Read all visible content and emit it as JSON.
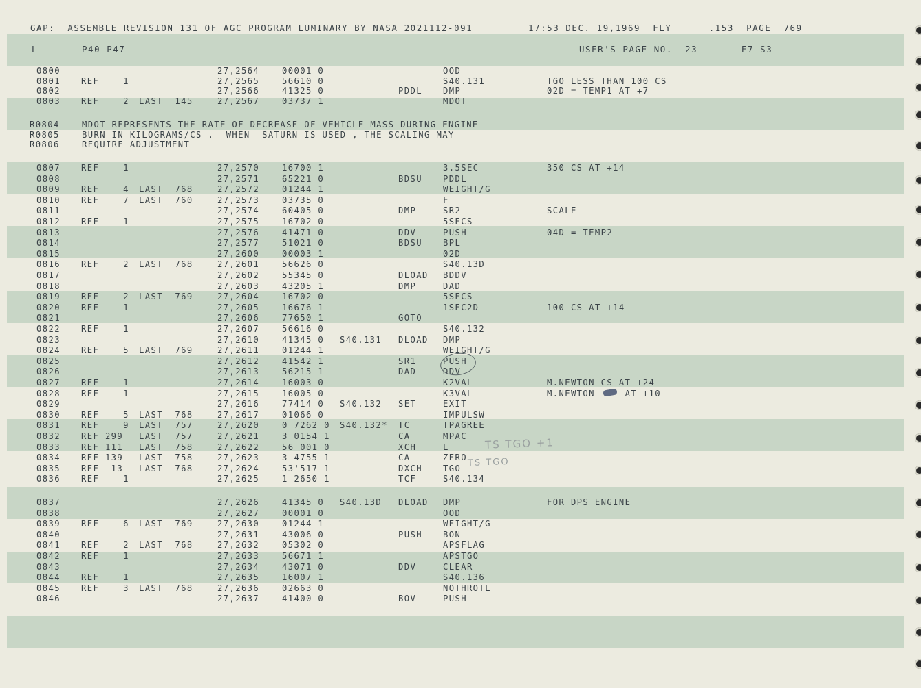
{
  "header": {
    "line1_left": "GAP:  ASSEMBLE REVISION 131 OF AGC PROGRAM LUMINARY BY NASA 2021112-091",
    "line1_right": "17:53 DEC. 19,1969  FLY      .153  PAGE  769",
    "band_l": "L",
    "band_section": "P40-P47",
    "band_users_page": "USER'S PAGE NO.  23",
    "band_code": "E7 S3"
  },
  "remarks": [
    {
      "line": "R0804",
      "text": "MDOT REPRESENTS THE RATE OF DECREASE OF VEHICLE MASS DURING ENGINE"
    },
    {
      "line": "R0805",
      "text": "BURN IN KILOGRAMS/CS .  WHEN  SATURN IS USED , THE SCALING MAY"
    },
    {
      "line": "R0806",
      "text": "REQUIRE ADJUSTMENT"
    }
  ],
  "rows_a": [
    {
      "line": "0800",
      "ref": "",
      "last": "",
      "addr": "27,2564",
      "word": "00001 0",
      "label": "",
      "op": "",
      "operand": "OOD",
      "comment": ""
    },
    {
      "line": "0801",
      "ref": "REF    1",
      "last": "",
      "addr": "27,2565",
      "word": "56610 0",
      "label": "",
      "op": "",
      "operand": "S40.131",
      "comment": "TGO LESS THAN 100 CS"
    },
    {
      "line": "0802",
      "ref": "",
      "last": "",
      "addr": "27,2566",
      "word": "41325 0",
      "label": "",
      "op": "PDDL",
      "operand": "DMP",
      "comment": "02D = TEMP1 AT +7"
    },
    {
      "line": "0803",
      "ref": "REF    2",
      "last": "LAST  145",
      "addr": "27,2567",
      "word": "03737 1",
      "label": "",
      "op": "",
      "operand": "MDOT",
      "comment": ""
    }
  ],
  "rows_b": [
    {
      "line": "0807",
      "ref": "REF    1",
      "last": "",
      "addr": "27,2570",
      "word": "16700 1",
      "label": "",
      "op": "",
      "operand": "3.5SEC",
      "comment": "350 CS AT +14"
    },
    {
      "line": "0808",
      "ref": "",
      "last": "",
      "addr": "27,2571",
      "word": "65221 0",
      "label": "",
      "op": "BDSU",
      "operand": "PDDL",
      "comment": ""
    },
    {
      "line": "0809",
      "ref": "REF    4",
      "last": "LAST  768",
      "addr": "27,2572",
      "word": "01244 1",
      "label": "",
      "op": "",
      "operand": "WEIGHT/G",
      "comment": ""
    },
    {
      "line": "0810",
      "ref": "REF    7",
      "last": "LAST  760",
      "addr": "27,2573",
      "word": "03735 0",
      "label": "",
      "op": "",
      "operand": "F",
      "comment": ""
    },
    {
      "line": "0811",
      "ref": "",
      "last": "",
      "addr": "27,2574",
      "word": "60405 0",
      "label": "",
      "op": "DMP",
      "operand": "SR2",
      "comment": "SCALE"
    },
    {
      "line": "0812",
      "ref": "REF    1",
      "last": "",
      "addr": "27,2575",
      "word": "16702 0",
      "label": "",
      "op": "",
      "operand": "5SECS",
      "comment": ""
    },
    {
      "line": "0813",
      "ref": "",
      "last": "",
      "addr": "27,2576",
      "word": "41471 0",
      "label": "",
      "op": "DDV",
      "operand": "PUSH",
      "comment": "04D = TEMP2"
    },
    {
      "line": "0814",
      "ref": "",
      "last": "",
      "addr": "27,2577",
      "word": "51021 0",
      "label": "",
      "op": "BDSU",
      "operand": "BPL",
      "comment": ""
    },
    {
      "line": "0815",
      "ref": "",
      "last": "",
      "addr": "27,2600",
      "word": "00003 1",
      "label": "",
      "op": "",
      "operand": "02D",
      "comment": ""
    },
    {
      "line": "0816",
      "ref": "REF    2",
      "last": "LAST  768",
      "addr": "27,2601",
      "word": "56626 0",
      "label": "",
      "op": "",
      "operand": "S40.13D",
      "comment": ""
    },
    {
      "line": "0817",
      "ref": "",
      "last": "",
      "addr": "27,2602",
      "word": "55345 0",
      "label": "",
      "op": "DLOAD",
      "operand": "BDDV",
      "comment": ""
    },
    {
      "line": "0818",
      "ref": "",
      "last": "",
      "addr": "27,2603",
      "word": "43205 1",
      "label": "",
      "op": "DMP",
      "operand": "DAD",
      "comment": ""
    },
    {
      "line": "0819",
      "ref": "REF    2",
      "last": "LAST  769",
      "addr": "27,2604",
      "word": "16702 0",
      "label": "",
      "op": "",
      "operand": "5SECS",
      "comment": ""
    },
    {
      "line": "0820",
      "ref": "REF    1",
      "last": "",
      "addr": "27,2605",
      "word": "16676 1",
      "label": "",
      "op": "",
      "operand": "1SEC2D",
      "comment": "100 CS AT +14"
    },
    {
      "line": "0821",
      "ref": "",
      "last": "",
      "addr": "27,2606",
      "word": "77650 1",
      "label": "",
      "op": "GOTO",
      "operand": "",
      "comment": ""
    },
    {
      "line": "0822",
      "ref": "REF    1",
      "last": "",
      "addr": "27,2607",
      "word": "56616 0",
      "label": "",
      "op": "",
      "operand": "S40.132",
      "comment": ""
    },
    {
      "line": "0823",
      "ref": "",
      "last": "",
      "addr": "27,2610",
      "word": "41345 0",
      "label": "S40.131",
      "op": "DLOAD",
      "operand": "DMP",
      "comment": ""
    },
    {
      "line": "0824",
      "ref": "REF    5",
      "last": "LAST  769",
      "addr": "27,2611",
      "word": "01244 1",
      "label": "",
      "op": "",
      "operand": "WEIGHT/G",
      "comment": ""
    },
    {
      "line": "0825",
      "ref": "",
      "last": "",
      "addr": "27,2612",
      "word": "41542 1",
      "label": "",
      "op": "SR1",
      "operand": "PUSH",
      "comment": ""
    },
    {
      "line": "0826",
      "ref": "",
      "last": "",
      "addr": "27,2613",
      "word": "56215 1",
      "label": "",
      "op": "DAD",
      "operand": "DDV",
      "comment": ""
    },
    {
      "line": "0827",
      "ref": "REF    1",
      "last": "",
      "addr": "27,2614",
      "word": "16003 0",
      "label": "",
      "op": "",
      "operand": "K2VAL",
      "comment": "M.NEWTON CS AT +24"
    },
    {
      "line": "0828",
      "ref": "REF    1",
      "last": "",
      "addr": "27,2615",
      "word": "16005 0",
      "label": "",
      "op": "",
      "operand": "K3VAL",
      "comment": "M.NEWTON     AT +10"
    },
    {
      "line": "0829",
      "ref": "",
      "last": "",
      "addr": "27,2616",
      "word": "77414 0",
      "label": "S40.132",
      "op": "SET",
      "operand": "EXIT",
      "comment": ""
    },
    {
      "line": "0830",
      "ref": "REF    5",
      "last": "LAST  768",
      "addr": "27,2617",
      "word": "01066 0",
      "label": "",
      "op": "",
      "operand": "IMPULSW",
      "comment": ""
    },
    {
      "line": "0831",
      "ref": "REF    9",
      "last": "LAST  757",
      "addr": "27,2620",
      "word": "0 7262 0",
      "label": "S40.132*",
      "op": "TC",
      "operand": "TPAGREE",
      "comment": ""
    },
    {
      "line": "0832",
      "ref": "REF 299",
      "last": "LAST  757",
      "addr": "27,2621",
      "word": "3 0154 1",
      "label": "",
      "op": "CA",
      "operand": "MPAC",
      "comment": ""
    },
    {
      "line": "0833",
      "ref": "REF 111",
      "last": "LAST  758",
      "addr": "27,2622",
      "word": "56 001 0",
      "label": "",
      "op": "XCH",
      "operand": "L",
      "comment": ""
    },
    {
      "line": "0834",
      "ref": "REF 139",
      "last": "LAST  758",
      "addr": "27,2623",
      "word": "3 4755 1",
      "label": "",
      "op": "CA",
      "operand": "ZERO",
      "comment": ""
    },
    {
      "line": "0835",
      "ref": "REF  13",
      "last": "LAST  768",
      "addr": "27,2624",
      "word": "53'517 1",
      "label": "",
      "op": "DXCH",
      "operand": "TGO",
      "comment": ""
    },
    {
      "line": "0836",
      "ref": "REF    1",
      "last": "",
      "addr": "27,2625",
      "word": "1 2650 1",
      "label": "",
      "op": "TCF",
      "operand": "S40.134",
      "comment": ""
    }
  ],
  "rows_c": [
    {
      "line": "0837",
      "ref": "",
      "last": "",
      "addr": "27,2626",
      "word": "41345 0",
      "label": "S40.13D",
      "op": "DLOAD",
      "operand": "DMP",
      "comment": "FOR DPS ENGINE"
    },
    {
      "line": "0838",
      "ref": "",
      "last": "",
      "addr": "27,2627",
      "word": "00001 0",
      "label": "",
      "op": "",
      "operand": "OOD",
      "comment": ""
    },
    {
      "line": "0839",
      "ref": "REF    6",
      "last": "LAST  769",
      "addr": "27,2630",
      "word": "01244 1",
      "label": "",
      "op": "",
      "operand": "WEIGHT/G",
      "comment": ""
    },
    {
      "line": "0840",
      "ref": "",
      "last": "",
      "addr": "27,2631",
      "word": "43006 0",
      "label": "",
      "op": "PUSH",
      "operand": "BON",
      "comment": ""
    },
    {
      "line": "0841",
      "ref": "REF    2",
      "last": "LAST  768",
      "addr": "27,2632",
      "word": "05302 0",
      "label": "",
      "op": "",
      "operand": "APSFLAG",
      "comment": ""
    },
    {
      "line": "0842",
      "ref": "REF    1",
      "last": "",
      "addr": "27,2633",
      "word": "56671 1",
      "label": "",
      "op": "",
      "operand": "APSTGO",
      "comment": ""
    },
    {
      "line": "0843",
      "ref": "",
      "last": "",
      "addr": "27,2634",
      "word": "43071 0",
      "label": "",
      "op": "DDV",
      "operand": "CLEAR",
      "comment": ""
    },
    {
      "line": "0844",
      "ref": "REF    1",
      "last": "",
      "addr": "27,2635",
      "word": "16007 1",
      "label": "",
      "op": "",
      "operand": "S40.136",
      "comment": ""
    },
    {
      "line": "0845",
      "ref": "REF    3",
      "last": "LAST  768",
      "addr": "27,2636",
      "word": "02663 0",
      "label": "",
      "op": "",
      "operand": "NOTHROTL",
      "comment": ""
    },
    {
      "line": "0846",
      "ref": "",
      "last": "",
      "addr": "27,2637",
      "word": "41400 0",
      "label": "",
      "op": "BOV",
      "operand": "PUSH",
      "comment": ""
    }
  ],
  "annotations": {
    "pencil_1": "TS  TGO  +1",
    "pencil_2": "TS    TGO"
  },
  "colors": {
    "paper": "#ecebe0",
    "band": "#c8d6c6",
    "ink": "#3b4348"
  }
}
